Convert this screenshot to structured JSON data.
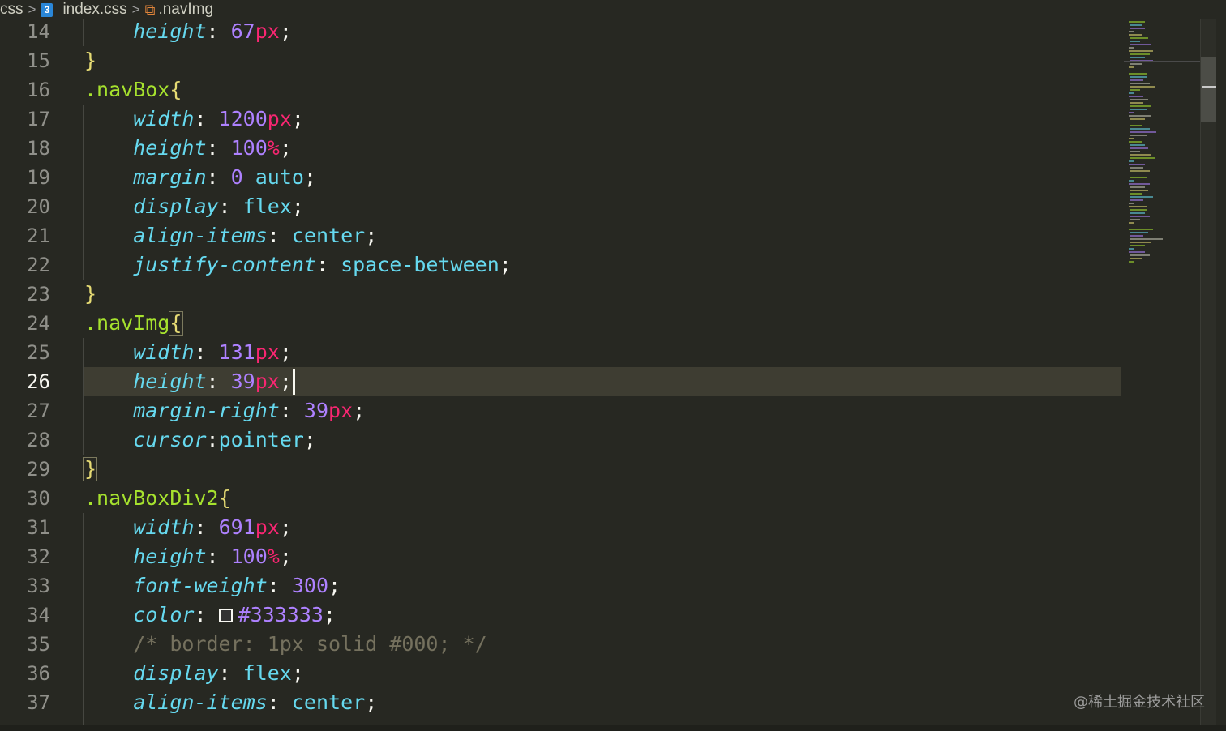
{
  "breadcrumb": {
    "folder": "css",
    "file_icon": "css3-icon",
    "file": "index.css",
    "selector_icon": "selector-symbol-icon",
    "selector": ".navImg"
  },
  "editor": {
    "current_line": 26,
    "lines": [
      {
        "n": "14",
        "indent": true,
        "tokens": [
          {
            "t": "height",
            "c": "t-prop"
          },
          {
            "t": ": ",
            "c": "t-punc"
          },
          {
            "t": "67",
            "c": "t-num"
          },
          {
            "t": "px",
            "c": "t-unit"
          },
          {
            "t": ";",
            "c": "t-punc"
          }
        ]
      },
      {
        "n": "15",
        "indent": false,
        "tokens": [
          {
            "t": "}",
            "c": "t-brace"
          }
        ]
      },
      {
        "n": "16",
        "indent": false,
        "tokens": [
          {
            "t": ".navBox",
            "c": "t-sel"
          },
          {
            "t": "{",
            "c": "t-brace"
          }
        ]
      },
      {
        "n": "17",
        "indent": true,
        "tokens": [
          {
            "t": "width",
            "c": "t-prop"
          },
          {
            "t": ": ",
            "c": "t-punc"
          },
          {
            "t": "1200",
            "c": "t-num"
          },
          {
            "t": "px",
            "c": "t-unit"
          },
          {
            "t": ";",
            "c": "t-punc"
          }
        ]
      },
      {
        "n": "18",
        "indent": true,
        "tokens": [
          {
            "t": "height",
            "c": "t-prop"
          },
          {
            "t": ": ",
            "c": "t-punc"
          },
          {
            "t": "100",
            "c": "t-num"
          },
          {
            "t": "%",
            "c": "t-unit"
          },
          {
            "t": ";",
            "c": "t-punc"
          }
        ]
      },
      {
        "n": "19",
        "indent": true,
        "tokens": [
          {
            "t": "margin",
            "c": "t-prop"
          },
          {
            "t": ": ",
            "c": "t-punc"
          },
          {
            "t": "0",
            "c": "t-num"
          },
          {
            "t": " ",
            "c": "t-punc"
          },
          {
            "t": "auto",
            "c": "t-val"
          },
          {
            "t": ";",
            "c": "t-punc"
          }
        ]
      },
      {
        "n": "20",
        "indent": true,
        "tokens": [
          {
            "t": "display",
            "c": "t-prop"
          },
          {
            "t": ": ",
            "c": "t-punc"
          },
          {
            "t": "flex",
            "c": "t-val"
          },
          {
            "t": ";",
            "c": "t-punc"
          }
        ]
      },
      {
        "n": "21",
        "indent": true,
        "tokens": [
          {
            "t": "align-items",
            "c": "t-prop"
          },
          {
            "t": ": ",
            "c": "t-punc"
          },
          {
            "t": "center",
            "c": "t-val"
          },
          {
            "t": ";",
            "c": "t-punc"
          }
        ]
      },
      {
        "n": "22",
        "indent": true,
        "tokens": [
          {
            "t": "justify-content",
            "c": "t-prop"
          },
          {
            "t": ": ",
            "c": "t-punc"
          },
          {
            "t": "space-between",
            "c": "t-val"
          },
          {
            "t": ";",
            "c": "t-punc"
          }
        ]
      },
      {
        "n": "23",
        "indent": false,
        "tokens": [
          {
            "t": "}",
            "c": "t-brace"
          }
        ]
      },
      {
        "n": "24",
        "indent": false,
        "tokens": [
          {
            "t": ".navImg",
            "c": "t-sel"
          },
          {
            "t": "{",
            "c": "t-brace"
          }
        ]
      },
      {
        "n": "25",
        "indent": true,
        "tokens": [
          {
            "t": "width",
            "c": "t-prop"
          },
          {
            "t": ": ",
            "c": "t-punc"
          },
          {
            "t": "131",
            "c": "t-num"
          },
          {
            "t": "px",
            "c": "t-unit"
          },
          {
            "t": ";",
            "c": "t-punc"
          }
        ]
      },
      {
        "n": "26",
        "indent": true,
        "tokens": [
          {
            "t": "height",
            "c": "t-prop"
          },
          {
            "t": ": ",
            "c": "t-punc"
          },
          {
            "t": "39",
            "c": "t-num"
          },
          {
            "t": "px",
            "c": "t-unit"
          },
          {
            "t": ";",
            "c": "t-punc"
          }
        ]
      },
      {
        "n": "27",
        "indent": true,
        "tokens": [
          {
            "t": "margin-right",
            "c": "t-prop"
          },
          {
            "t": ": ",
            "c": "t-punc"
          },
          {
            "t": "39",
            "c": "t-num"
          },
          {
            "t": "px",
            "c": "t-unit"
          },
          {
            "t": ";",
            "c": "t-punc"
          }
        ]
      },
      {
        "n": "28",
        "indent": true,
        "tokens": [
          {
            "t": "cursor",
            "c": "t-prop"
          },
          {
            "t": ":",
            "c": "t-punc"
          },
          {
            "t": "pointer",
            "c": "t-val"
          },
          {
            "t": ";",
            "c": "t-punc"
          }
        ]
      },
      {
        "n": "29",
        "indent": false,
        "tokens": [
          {
            "t": "}",
            "c": "t-brace"
          }
        ]
      },
      {
        "n": "30",
        "indent": false,
        "tokens": [
          {
            "t": ".navBoxDiv2",
            "c": "t-sel"
          },
          {
            "t": "{",
            "c": "t-brace"
          }
        ]
      },
      {
        "n": "31",
        "indent": true,
        "tokens": [
          {
            "t": "width",
            "c": "t-prop"
          },
          {
            "t": ": ",
            "c": "t-punc"
          },
          {
            "t": "691",
            "c": "t-num"
          },
          {
            "t": "px",
            "c": "t-unit"
          },
          {
            "t": ";",
            "c": "t-punc"
          }
        ]
      },
      {
        "n": "32",
        "indent": true,
        "tokens": [
          {
            "t": "height",
            "c": "t-prop"
          },
          {
            "t": ": ",
            "c": "t-punc"
          },
          {
            "t": "100",
            "c": "t-num"
          },
          {
            "t": "%",
            "c": "t-unit"
          },
          {
            "t": ";",
            "c": "t-punc"
          }
        ]
      },
      {
        "n": "33",
        "indent": true,
        "tokens": [
          {
            "t": "font-weight",
            "c": "t-prop"
          },
          {
            "t": ": ",
            "c": "t-punc"
          },
          {
            "t": "300",
            "c": "t-num"
          },
          {
            "t": ";",
            "c": "t-punc"
          }
        ]
      },
      {
        "n": "34",
        "indent": true,
        "tokens": [
          {
            "t": "color",
            "c": "t-prop"
          },
          {
            "t": ": ",
            "c": "t-punc"
          },
          {
            "t": "",
            "c": "swatch"
          },
          {
            "t": "#333333",
            "c": "t-hex"
          },
          {
            "t": ";",
            "c": "t-punc"
          }
        ]
      },
      {
        "n": "35",
        "indent": true,
        "tokens": [
          {
            "t": "/* border: 1px solid #000; */",
            "c": "t-comment"
          }
        ]
      },
      {
        "n": "36",
        "indent": true,
        "tokens": [
          {
            "t": "display",
            "c": "t-prop"
          },
          {
            "t": ": ",
            "c": "t-punc"
          },
          {
            "t": "flex",
            "c": "t-val"
          },
          {
            "t": ";",
            "c": "t-punc"
          }
        ]
      },
      {
        "n": "37",
        "indent": true,
        "tokens": [
          {
            "t": "align-items",
            "c": "t-prop"
          },
          {
            "t": ": ",
            "c": "t-punc"
          },
          {
            "t": "center",
            "c": "t-val"
          },
          {
            "t": ";",
            "c": "t-punc"
          }
        ]
      }
    ]
  },
  "colors": {
    "background": "#272822",
    "property": "#66d9ef",
    "number": "#ae81ff",
    "unit": "#f92672",
    "selector": "#a6e22e",
    "brace": "#e6db74",
    "comment": "#75715e",
    "swatch": "#333333"
  },
  "watermark": "@稀土掘金技术社区"
}
